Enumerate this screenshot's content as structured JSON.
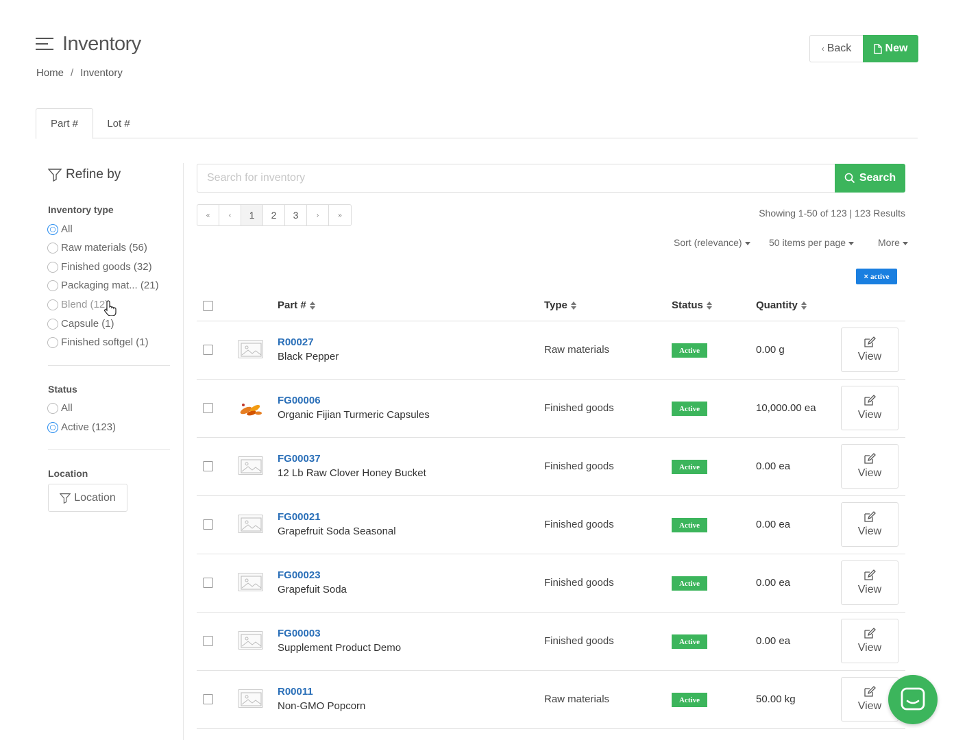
{
  "header": {
    "title": "Inventory",
    "breadcrumb": [
      "Home",
      "Inventory"
    ],
    "back_label": "Back",
    "new_label": "New"
  },
  "tabs": [
    {
      "label": "Part #",
      "active": true
    },
    {
      "label": "Lot #",
      "active": false
    }
  ],
  "sidebar": {
    "refine_label": "Refine by",
    "inventory_type": {
      "heading": "Inventory type",
      "options": [
        {
          "label": "All",
          "checked": true
        },
        {
          "label": "Raw materials (56)",
          "checked": false
        },
        {
          "label": "Finished goods (32)",
          "checked": false
        },
        {
          "label": "Packaging mat... (21)",
          "checked": false
        },
        {
          "label": "Blend (12)",
          "checked": false
        },
        {
          "label": "Capsule (1)",
          "checked": false
        },
        {
          "label": "Finished softgel (1)",
          "checked": false
        }
      ]
    },
    "status": {
      "heading": "Status",
      "options": [
        {
          "label": "All",
          "checked": false
        },
        {
          "label": "Active (123)",
          "checked": true
        }
      ]
    },
    "location": {
      "heading": "Location",
      "button_label": "Location"
    }
  },
  "search": {
    "placeholder": "Search for inventory",
    "button_label": "Search"
  },
  "pagination": {
    "first": "«",
    "prev": "‹",
    "pages": [
      "1",
      "2",
      "3"
    ],
    "next": "›",
    "last": "»"
  },
  "results": {
    "showing_text": "Showing 1-50 of 123 | 123 Results",
    "sort_label": "Sort (relevance)",
    "per_page_label": "50 items per page",
    "more_label": "More",
    "active_chip": "active"
  },
  "table": {
    "columns": {
      "part": "Part #",
      "type": "Type",
      "status": "Status",
      "quantity": "Quantity"
    },
    "view_label": "View",
    "rows": [
      {
        "id": "R00027",
        "name": "Black Pepper",
        "type": "Raw materials",
        "status": "Active",
        "quantity": "0.00 g",
        "image": "placeholder"
      },
      {
        "id": "FG00006",
        "name": "Organic Fijian Turmeric Capsules",
        "type": "Finished goods",
        "status": "Active",
        "quantity": "10,000.00 ea",
        "image": "photo"
      },
      {
        "id": "FG00037",
        "name": "12 Lb Raw Clover Honey Bucket",
        "type": "Finished goods",
        "status": "Active",
        "quantity": "0.00 ea",
        "image": "placeholder"
      },
      {
        "id": "FG00021",
        "name": "Grapefruit Soda Seasonal",
        "type": "Finished goods",
        "status": "Active",
        "quantity": "0.00 ea",
        "image": "placeholder"
      },
      {
        "id": "FG00023",
        "name": "Grapefuit Soda",
        "type": "Finished goods",
        "status": "Active",
        "quantity": "0.00 ea",
        "image": "placeholder"
      },
      {
        "id": "FG00003",
        "name": "Supplement Product Demo",
        "type": "Finished goods",
        "status": "Active",
        "quantity": "0.00 ea",
        "image": "placeholder"
      },
      {
        "id": "R00011",
        "name": "Non-GMO Popcorn",
        "type": "Raw materials",
        "status": "Active",
        "quantity": "50.00 kg",
        "image": "placeholder"
      }
    ]
  },
  "colors": {
    "accent_green": "#3cb55c",
    "link_blue": "#2a6fb8",
    "chip_blue": "#1a7fe0"
  }
}
